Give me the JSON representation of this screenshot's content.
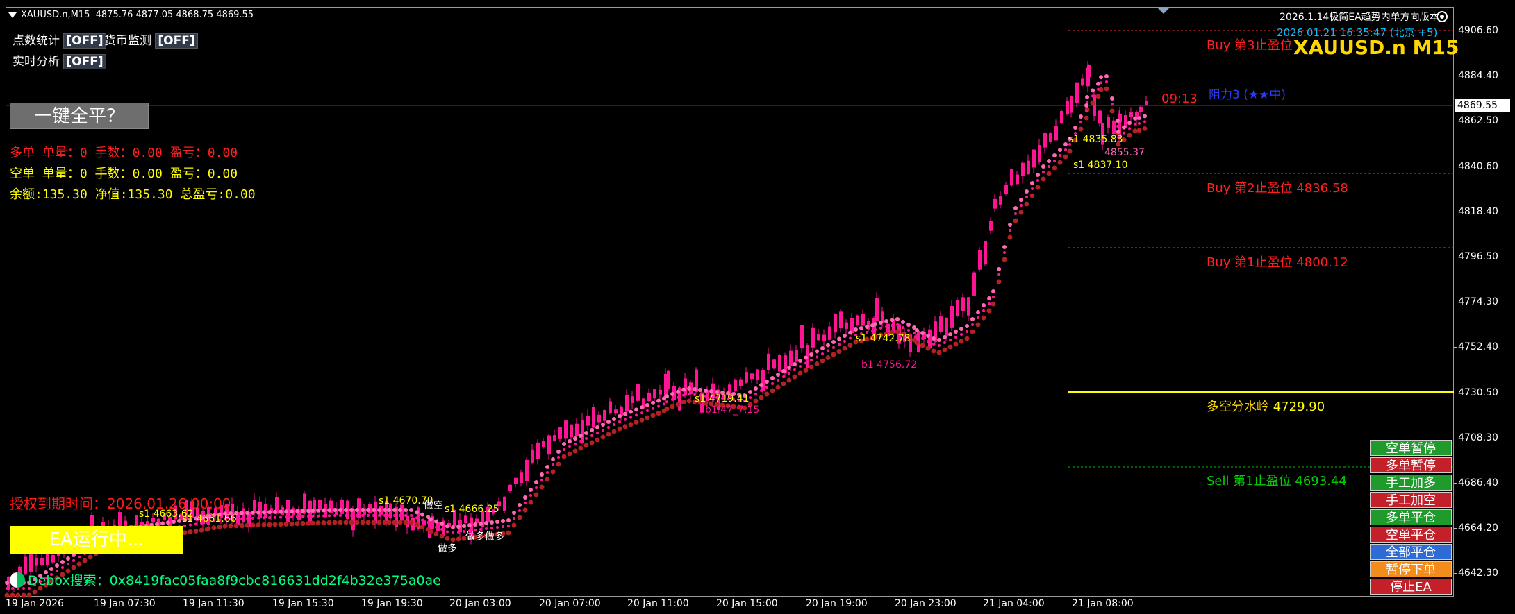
{
  "window": {
    "symbol_period": "XAUUSD.n,M15",
    "ohlc": "4875.76 4877.05 4868.75 4869.55"
  },
  "header_right": {
    "ea_version": "2026.1.14极简EA趋势内单方向版本",
    "datetime": "2026.01.21 16:35:47 (北京 +5)",
    "symbol_big": "XAUUSD.n M15"
  },
  "toggles": {
    "points_stat": {
      "label": "点数统计",
      "state": "[OFF]"
    },
    "currency_watch": {
      "label": "货币监测",
      "state": "[OFF]"
    },
    "realtime_analysis": {
      "label": "实时分析",
      "state": "[OFF]"
    }
  },
  "close_all_button": "一键全平？",
  "stats": {
    "long": "多单  单量：0 手数：0.00 盈亏：0.00",
    "short": "空单  单量：0 手数：0.00 盈亏：0.00",
    "account": "余额:135.30 净值:135.30 总盈亏:0.00"
  },
  "resistance": "阻力3 (★★中)",
  "countdown": "09:13",
  "levels": {
    "buy3": "Buy 第3止盈位",
    "buy2": "Buy 第2止盈位 4836.58",
    "buy1": "Buy 第1止盈位 4800.12",
    "watershed_label": "多空分水岭",
    "watershed_value": "4729.90",
    "sell1": "Sell 第1止盈位 4693.44"
  },
  "license": "授权到期时间：2026.01.26 00:00",
  "ea_status": "EA运行中...",
  "debox": "Debox搜索：0x8419fac05faa8f9cbc816631dd2f4b32e375a0ae",
  "current_price": "4869.55",
  "y_axis": [
    "4906.60",
    "4884.40",
    "4862.50",
    "4840.60",
    "4818.40",
    "4796.50",
    "4774.30",
    "4752.40",
    "4730.50",
    "4708.30",
    "4686.40",
    "4664.20",
    "4642.30"
  ],
  "x_axis": [
    "19 Jan 2026",
    "19 Jan 07:30",
    "19 Jan 11:30",
    "19 Jan 15:30",
    "19 Jan 19:30",
    "20 Jan 03:00",
    "20 Jan 07:00",
    "20 Jan 11:00",
    "20 Jan 15:00",
    "20 Jan 19:00",
    "20 Jan 23:00",
    "21 Jan 04:00",
    "21 Jan 08:00"
  ],
  "panel_buttons": [
    {
      "label": "空单暂停",
      "color": "#1f9b2c"
    },
    {
      "label": "多单暂停",
      "color": "#c3202a"
    },
    {
      "label": "手工加多",
      "color": "#1f9b2c"
    },
    {
      "label": "手工加空",
      "color": "#c3202a"
    },
    {
      "label": "多单平仓",
      "color": "#1f9b2c"
    },
    {
      "label": "空单平仓",
      "color": "#c3202a"
    },
    {
      "label": "全部平仓",
      "color": "#2f6bd6"
    },
    {
      "label": "暂停下单",
      "color": "#f28c1b"
    },
    {
      "label": "停止EA",
      "color": "#c3202a"
    }
  ],
  "trade_marks": [
    "s1 4835.83",
    "s1 4837.10",
    "4855.37",
    "s1 4742.78",
    "b1 4756.72",
    "s1 4719.41",
    "b1 47_7.15",
    "s1 4670.70",
    "s1 4666.25",
    "s1 4663.62",
    "s1 4661.66",
    "做多",
    "做多做多",
    "做空"
  ],
  "colors": {
    "candle": "#ff1493",
    "ma_fast": "#ff69b4",
    "ma_mid": "#ff1493",
    "ma_slow": "#b22222",
    "buy_level": "#ff3030",
    "sell_level": "#00c000",
    "watershed": "#ffff00"
  }
}
